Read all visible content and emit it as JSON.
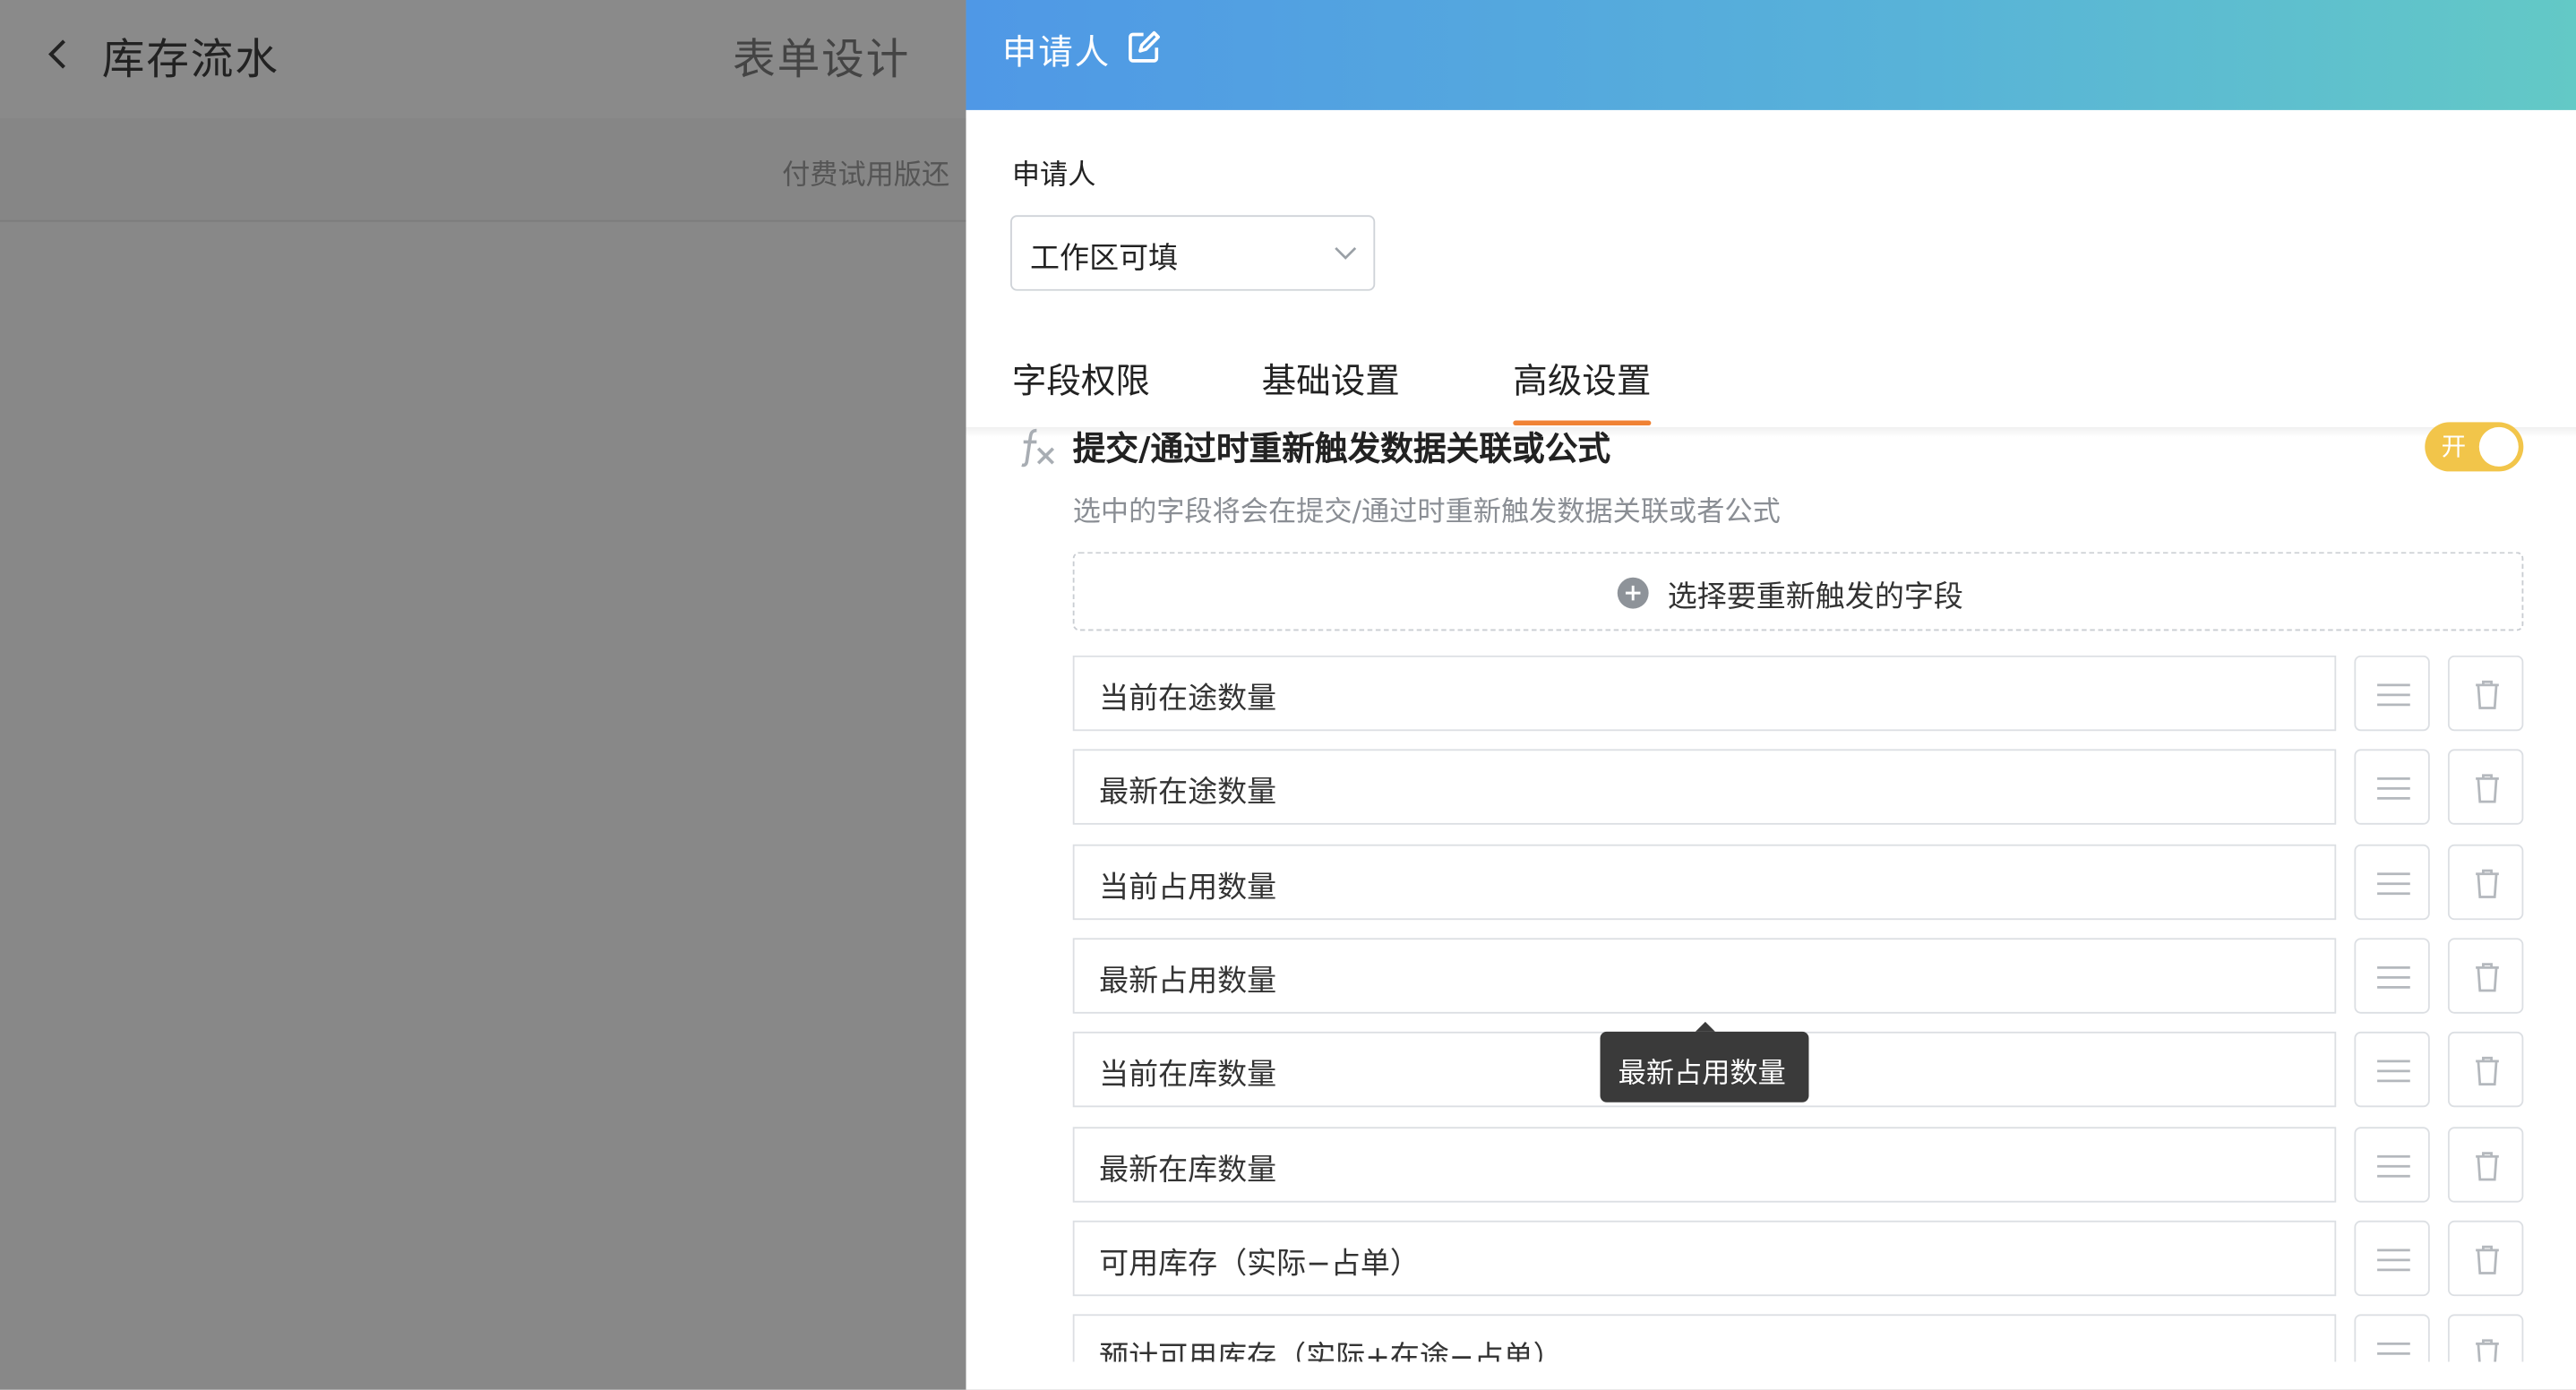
{
  "background": {
    "page_title": "库存流水",
    "center_tab": "表单设计",
    "banner_text": "付费试用版还"
  },
  "drawer": {
    "title": "申请人",
    "section_label": "申请人",
    "permission_select": {
      "value": "工作区可填"
    },
    "tabs": [
      {
        "label": "字段权限",
        "active": false
      },
      {
        "label": "基础设置",
        "active": false
      },
      {
        "label": "高级设置",
        "active": true
      }
    ],
    "retrigger": {
      "title": "提交/通过时重新触发数据关联或公式",
      "toggle_label": "开",
      "toggle_on": true,
      "description": "选中的字段将会在提交/通过时重新触发数据关联或者公式",
      "add_button": "选择要重新触发的字段",
      "fields": [
        "当前在途数量",
        "最新在途数量",
        "当前占用数量",
        "最新占用数量",
        "当前在库数量",
        "最新在库数量",
        "可用库存（实际−占单）",
        "预计可用库存（实际+在途−占单）"
      ]
    },
    "tooltip": "最新占用数量"
  },
  "colors": {
    "header_gradient_start": "#4f98e6",
    "header_gradient_end": "#63c9c6",
    "active_tab_underline": "#f08234",
    "toggle_on": "#f2c54a",
    "overlay": "#888888"
  }
}
